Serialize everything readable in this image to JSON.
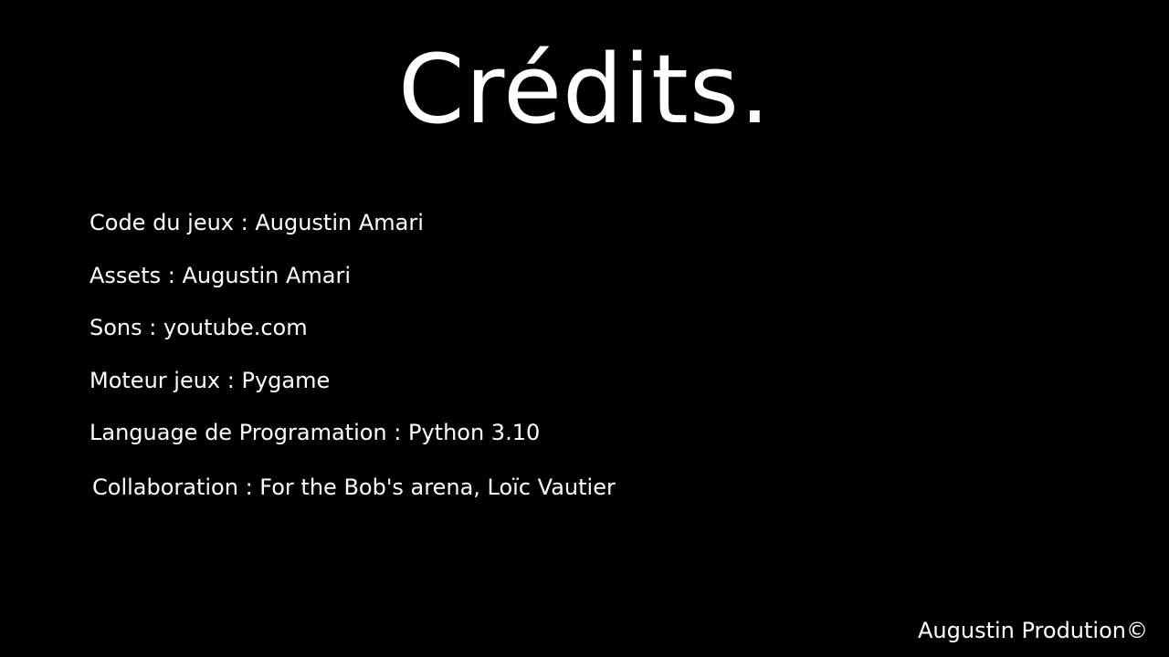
{
  "screen": {
    "title": "Crédits.",
    "background_color": "#000000",
    "text_color": "#ffffff"
  },
  "credits": [
    "Code du jeux : Augustin Amari",
    "Assets : Augustin Amari",
    "Sons : youtube.com",
    "Moteur jeux : Pygame",
    "Language de Programation : Python 3.10",
    "Collaboration : For the Bob's arena, Loïc Vautier"
  ],
  "footer": {
    "signature": "Augustin Prodution©"
  }
}
